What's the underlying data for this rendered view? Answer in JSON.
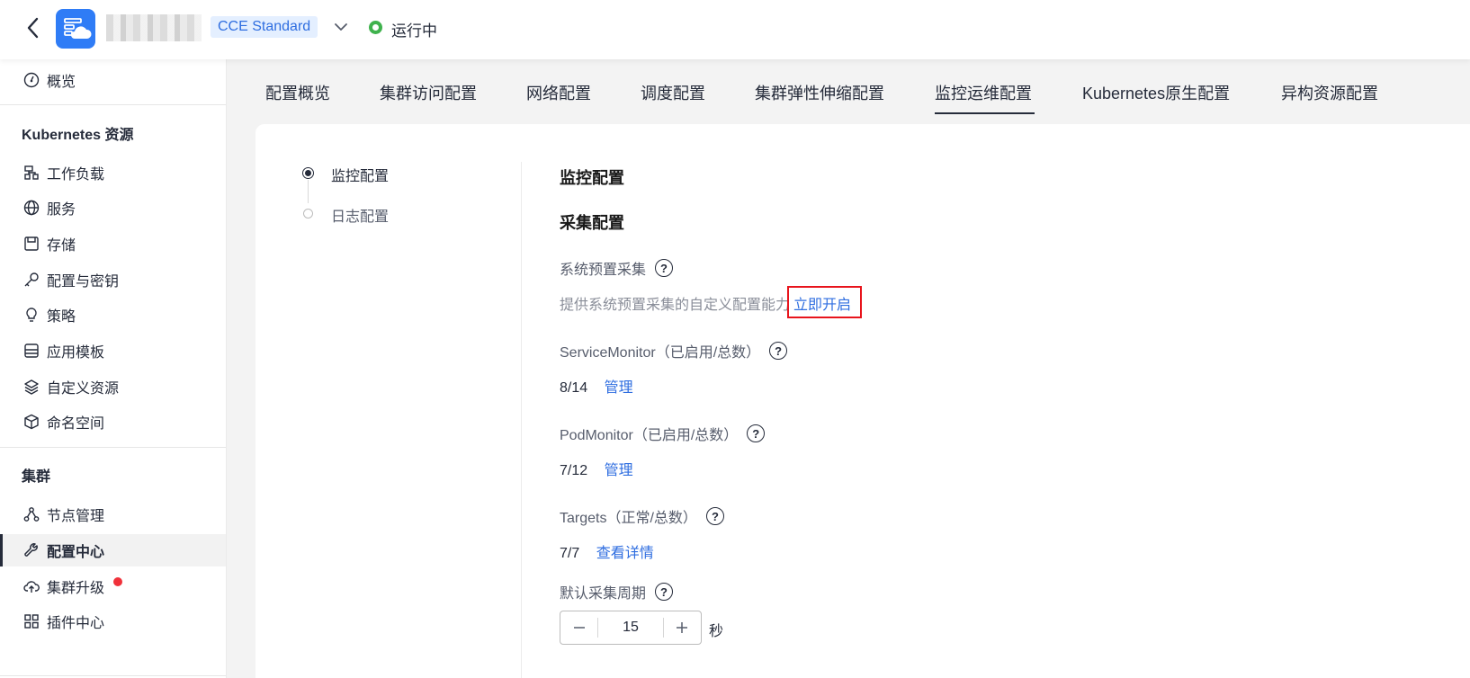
{
  "header": {
    "edition": "CCE Standard",
    "status": "运行中",
    "status_color": "#3fb24d",
    "accent": "#2f7cf6"
  },
  "sidebar": {
    "overview": "概览",
    "section_k8s": "Kubernetes 资源",
    "k8s_items": [
      "工作负载",
      "服务",
      "存储",
      "配置与密钥",
      "策略",
      "应用模板",
      "自定义资源",
      "命名空间"
    ],
    "section_cluster": "集群",
    "cluster_items": [
      "节点管理",
      "配置中心",
      "集群升级",
      "插件中心"
    ],
    "active_item": "配置中心"
  },
  "tabs": [
    "配置概览",
    "集群访问配置",
    "网络配置",
    "调度配置",
    "集群弹性伸缩配置",
    "监控运维配置",
    "Kubernetes原生配置",
    "异构资源配置"
  ],
  "active_tab": "监控运维配置",
  "anchors": [
    "监控配置",
    "日志配置"
  ],
  "content": {
    "title": "监控配置",
    "subtitle": "采集配置",
    "preset_label": "系统预置采集",
    "preset_desc": "提供系统预置采集的自定义配置能力",
    "preset_link": "立即开启",
    "service_monitor_label": "ServiceMonitor（已启用/总数）",
    "service_monitor_value": "8/14",
    "service_monitor_link": "管理",
    "pod_monitor_label": "PodMonitor（已启用/总数）",
    "pod_monitor_value": "7/12",
    "pod_monitor_link": "管理",
    "targets_label": "Targets（正常/总数）",
    "targets_value": "7/7",
    "targets_link": "查看详情",
    "period_label": "默认采集周期",
    "period_value": "15",
    "period_unit": "秒",
    "q": "?"
  }
}
